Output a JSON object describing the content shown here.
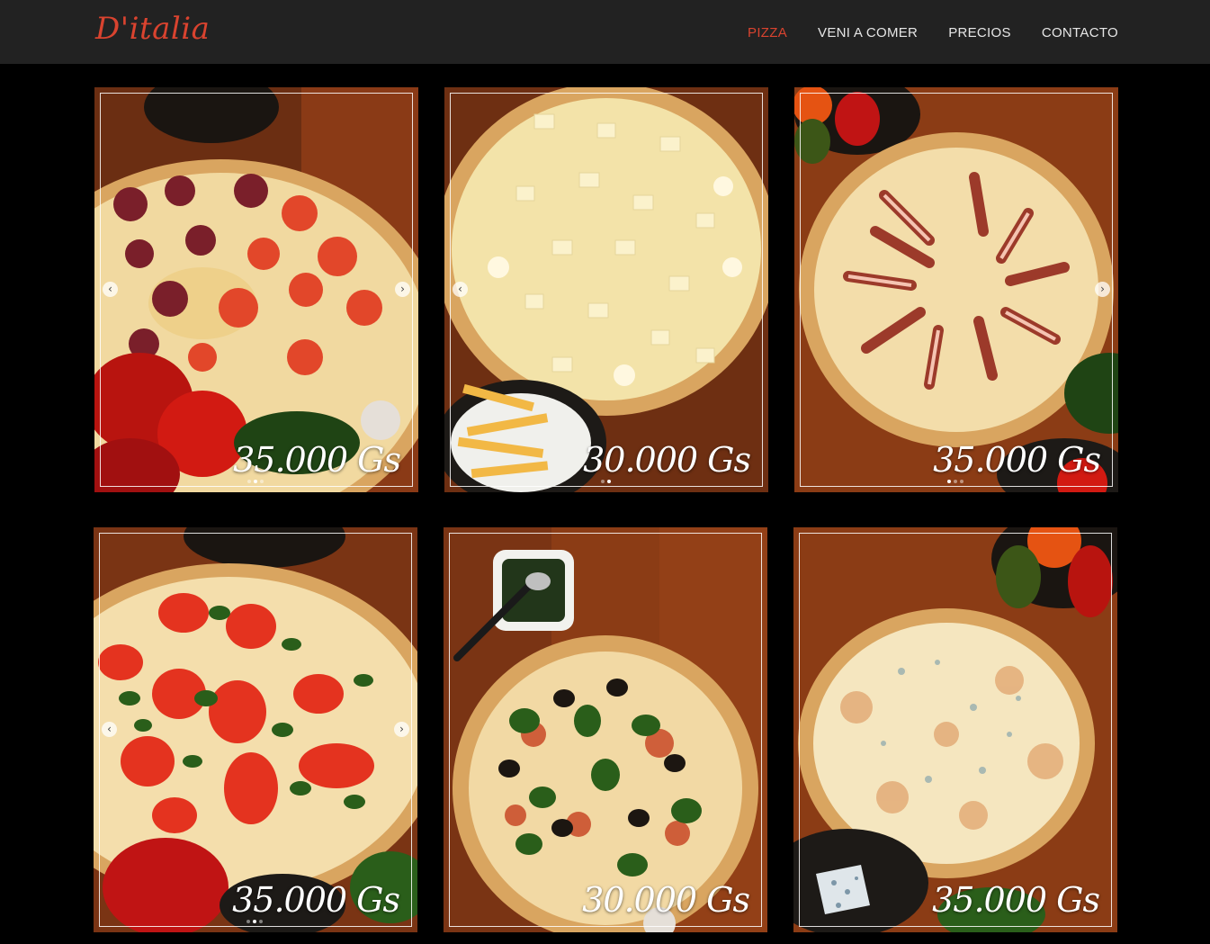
{
  "brand": {
    "name": "D'italia",
    "color": "#d9432f"
  },
  "nav": {
    "items": [
      {
        "label": "PIZZA",
        "active": true
      },
      {
        "label": "VENI A COMER",
        "active": false
      },
      {
        "label": "PRECIOS",
        "active": false
      },
      {
        "label": "CONTACTO",
        "active": false
      }
    ]
  },
  "products": [
    {
      "name": "pepperoni",
      "price": "35.000 Gs"
    },
    {
      "name": "palmito",
      "price": "30.000 Gs"
    },
    {
      "name": "bacon",
      "price": "35.000 Gs"
    },
    {
      "name": "tomato-basil",
      "price": "35.000 Gs"
    },
    {
      "name": "margherita-olives",
      "price": "30.000 Gs"
    },
    {
      "name": "four-cheese",
      "price": "35.000 Gs"
    }
  ],
  "icons": {
    "prev": "chevron-left-icon",
    "next": "chevron-right-icon"
  }
}
